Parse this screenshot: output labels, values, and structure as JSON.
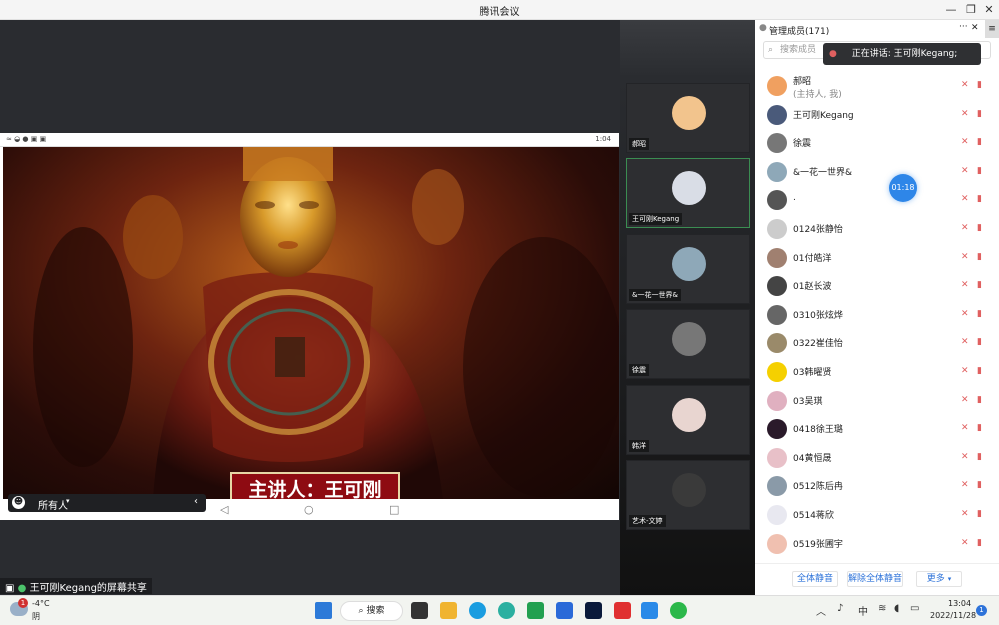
{
  "window": {
    "title": "腾讯会议"
  },
  "share": {
    "status_time": "1:04",
    "caption": "主讲人：王可刚",
    "chat_target": "所有人",
    "sharing_label": "王可刚Kegang的屏幕共享"
  },
  "gallery": [
    {
      "name": "郝昭",
      "color": "#f2c48d"
    },
    {
      "name": "王可刚Kegang",
      "color": "#d9dde6"
    },
    {
      "name": "&一花一世界&",
      "color": "#8ea8b8"
    },
    {
      "name": "徐震",
      "color": "#777777"
    },
    {
      "name": "韩洋",
      "color": "#e8d5d0"
    },
    {
      "name": "艺术-文婷",
      "color": "#3a3a3a"
    }
  ],
  "panel": {
    "title": "管理成员(171)",
    "search_placeholder": "搜索成员",
    "speaking": "正在讲话: 王可刚Kegang;",
    "timer": "01:18",
    "members": [
      {
        "name": "郝昭",
        "role": "(主持人, 我)",
        "color": "#f0a060"
      },
      {
        "name": "王可刚Kegang",
        "role": "",
        "color": "#4a5a7a"
      },
      {
        "name": "徐震",
        "role": "",
        "color": "#777777"
      },
      {
        "name": "&一花一世界&",
        "role": "",
        "color": "#8ea8b8"
      },
      {
        "name": ".",
        "role": "",
        "color": "#555555"
      },
      {
        "name": "0124张静怡",
        "role": "",
        "color": "#cccccc"
      },
      {
        "name": "01付皓洋",
        "role": "",
        "color": "#a08070"
      },
      {
        "name": "01赵长波",
        "role": "",
        "color": "#444444"
      },
      {
        "name": "0310张炫烨",
        "role": "",
        "color": "#666666"
      },
      {
        "name": "0322崔佳怡",
        "role": "",
        "color": "#9a8a6a"
      },
      {
        "name": "03韩曜贤",
        "role": "",
        "color": "#f5d000"
      },
      {
        "name": "03吴琪",
        "role": "",
        "color": "#e0b0c0"
      },
      {
        "name": "0418徐王璐",
        "role": "",
        "color": "#2a1a2a"
      },
      {
        "name": "04黄恒晟",
        "role": "",
        "color": "#e8c0c8"
      },
      {
        "name": "0512陈后冉",
        "role": "",
        "color": "#8a9aa8"
      },
      {
        "name": "0514蒋欣",
        "role": "",
        "color": "#e8e8f0"
      },
      {
        "name": "0519张圃宇",
        "role": "",
        "color": "#f0c0b0"
      }
    ],
    "mute_all": "全体静音",
    "unmute_all": "解除全体静音",
    "more": "更多"
  },
  "taskbar": {
    "weather_temp": "-4°C",
    "weather_desc": "阴",
    "weather_badge": "1",
    "search_label": "搜索",
    "ime": "中",
    "time": "13:04",
    "date": "2022/11/28",
    "notification_count": "1"
  }
}
